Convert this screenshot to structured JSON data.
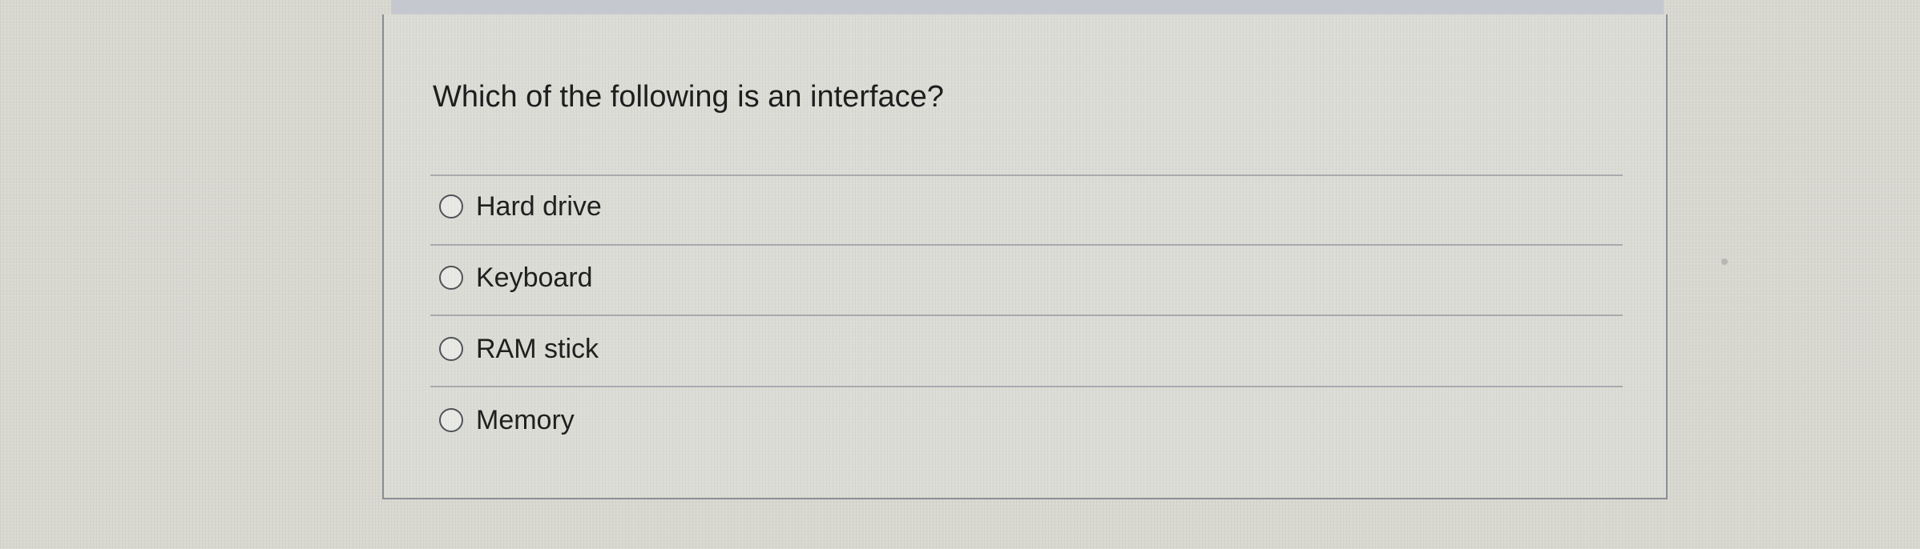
{
  "question": {
    "text": "Which of the following is an interface?"
  },
  "options": [
    {
      "label": "Hard drive"
    },
    {
      "label": "Keyboard"
    },
    {
      "label": "RAM stick"
    },
    {
      "label": "Memory"
    }
  ]
}
